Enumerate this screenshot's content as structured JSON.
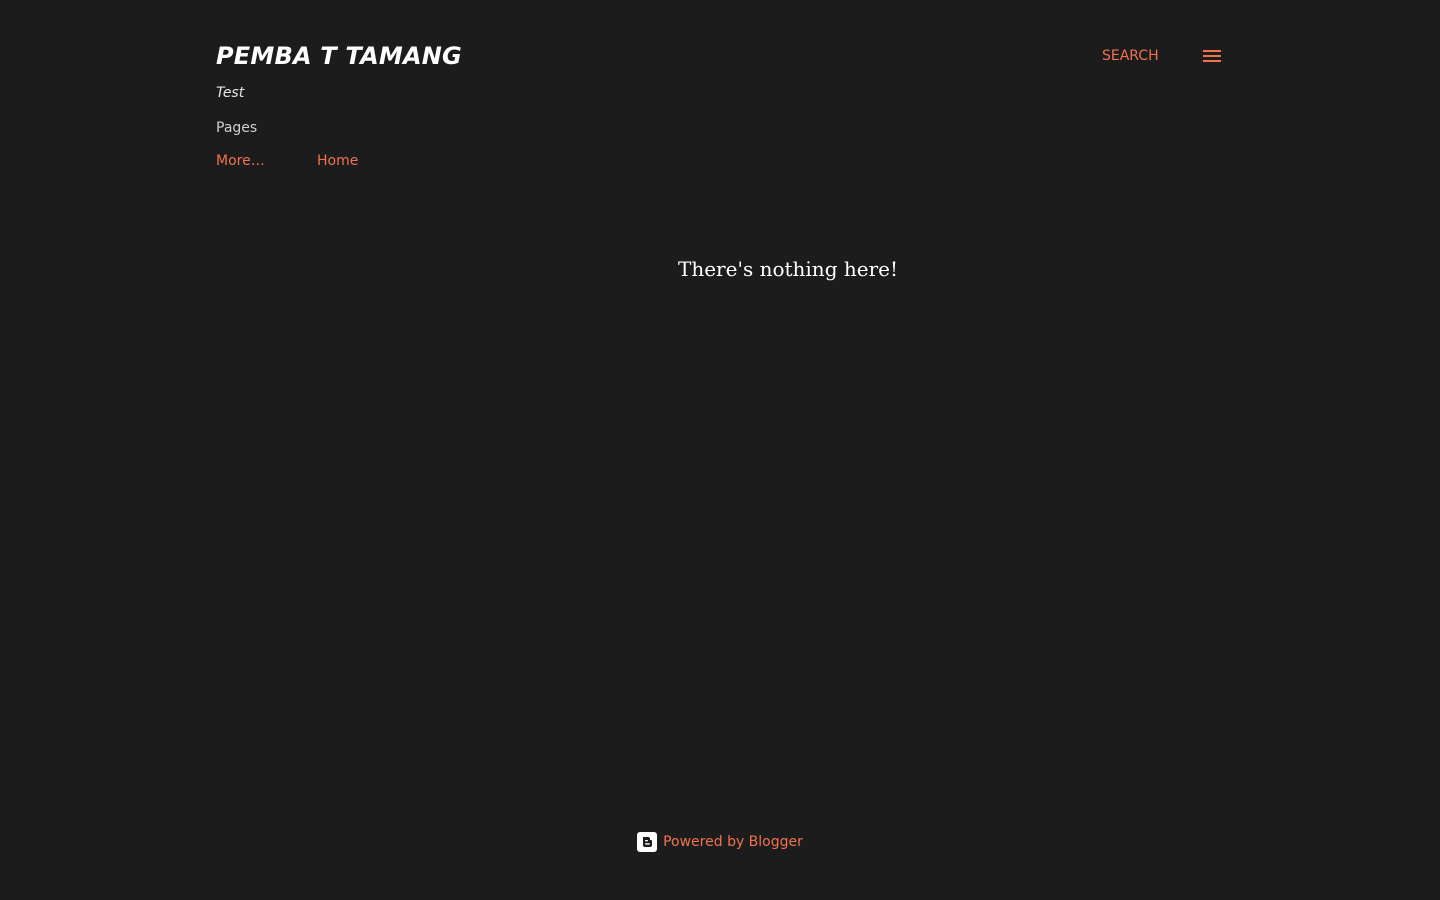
{
  "header": {
    "blog_title": "PEMBA T TAMANG",
    "description": "Test",
    "search_label": "SEARCH",
    "menu_icon": "hamburger-menu-icon"
  },
  "pages": {
    "heading": "Pages",
    "links": [
      {
        "label": "More…"
      },
      {
        "label": "Home"
      }
    ]
  },
  "main": {
    "empty_message": "There's nothing here!"
  },
  "footer": {
    "icon": "blogger-logo-icon",
    "powered_by": "Powered by Blogger"
  },
  "colors": {
    "background": "#1c1c1c",
    "accent": "#f0724f",
    "text": "#ffffff"
  }
}
